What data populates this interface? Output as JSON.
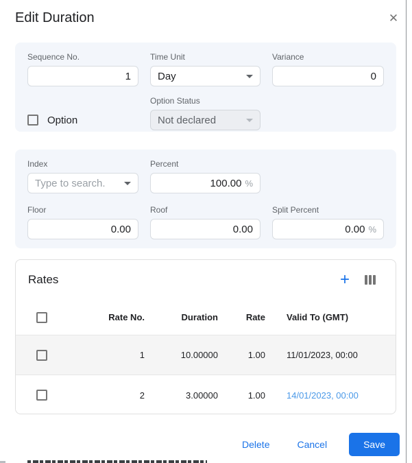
{
  "dialog": {
    "title": "Edit Duration"
  },
  "icons": {
    "close": "✕",
    "add": "+",
    "columns": "view-columns",
    "chevron": "chevron-down"
  },
  "section_general": {
    "sequence_no": {
      "label": "Sequence No.",
      "value": "1"
    },
    "time_unit": {
      "label": "Time Unit",
      "value": "Day"
    },
    "variance": {
      "label": "Variance",
      "value": "0"
    },
    "option": {
      "label": "Option",
      "checked": false
    },
    "option_status": {
      "label": "Option Status",
      "value": "Not declared",
      "disabled": true
    }
  },
  "section_index": {
    "index": {
      "label": "Index",
      "placeholder": "Type to search."
    },
    "percent": {
      "label": "Percent",
      "value": "100.00",
      "suffix": "%"
    },
    "floor": {
      "label": "Floor",
      "value": "0.00"
    },
    "roof": {
      "label": "Roof",
      "value": "0.00"
    },
    "split_percent": {
      "label": "Split Percent",
      "value": "0.00",
      "suffix": "%"
    }
  },
  "rates": {
    "title": "Rates",
    "columns": {
      "rate_no": "Rate No.",
      "duration": "Duration",
      "rate": "Rate",
      "valid_to": "Valid To (GMT)"
    },
    "rows": [
      {
        "rate_no": "1",
        "duration": "10.00000",
        "rate": "1.00",
        "valid_to": "11/01/2023, 00:00",
        "valid_to_is_link": false
      },
      {
        "rate_no": "2",
        "duration": "3.00000",
        "rate": "1.00",
        "valid_to": "14/01/2023, 00:00",
        "valid_to_is_link": true
      }
    ]
  },
  "footer": {
    "delete_label": "Delete",
    "cancel_label": "Cancel",
    "save_label": "Save"
  },
  "colors": {
    "accent_blue": "#1a73e8",
    "link_blue": "#4a99e8",
    "section_bg": "#f3f6fb",
    "row_stripe": "#f5f5f5",
    "label_gray": "#5f6368"
  }
}
